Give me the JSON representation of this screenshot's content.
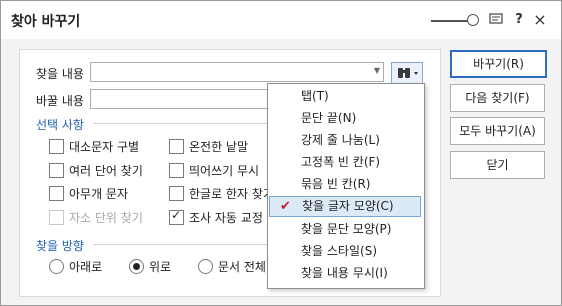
{
  "window": {
    "title": "찾아 바꾸기"
  },
  "titlebar": {
    "icons": [
      "slider-icon",
      "chat-icon",
      "help-icon",
      "close-icon"
    ],
    "help_glyph": "?",
    "close_glyph": "×"
  },
  "form": {
    "find_label": "찾을 내용",
    "find_value": "",
    "replace_label": "바꿀 내용",
    "replace_value": ""
  },
  "options": {
    "section_label": "선택 사항",
    "items": [
      {
        "label": "대소문자 구별",
        "checked": false,
        "enabled": true
      },
      {
        "label": "온전한 낱말",
        "checked": false,
        "enabled": true
      },
      {
        "label": "여러 단어 찾기",
        "checked": false,
        "enabled": true
      },
      {
        "label": "띄어쓰기 무시",
        "checked": false,
        "enabled": true
      },
      {
        "label": "아무개 문자",
        "checked": false,
        "enabled": true
      },
      {
        "label": "한글로 한자 찾기",
        "checked": false,
        "enabled": true
      },
      {
        "label": "자소 단위 찾기",
        "checked": false,
        "enabled": false
      },
      {
        "label": "조사 자동 교정",
        "checked": true,
        "enabled": true
      }
    ]
  },
  "direction": {
    "section_label": "찾을 방향",
    "options": [
      {
        "label": "아래로",
        "selected": false
      },
      {
        "label": "위로",
        "selected": true
      },
      {
        "label": "문서 전체",
        "selected": false
      }
    ]
  },
  "buttons": {
    "replace": "바꾸기(R)",
    "find_next": "다음 찾기(F)",
    "replace_all": "모두 바꾸기(A)",
    "close": "닫기"
  },
  "menu": {
    "items": [
      {
        "label": "탭(T)",
        "checked": false
      },
      {
        "label": "문단 끝(N)",
        "checked": false
      },
      {
        "label": "강제 줄 나눔(L)",
        "checked": false
      },
      {
        "label": "고정폭 빈 칸(F)",
        "checked": false
      },
      {
        "label": "묶음 빈 칸(R)",
        "checked": false
      },
      {
        "label": "찾을 글자 모양(C)",
        "checked": true
      },
      {
        "label": "찾을 문단 모양(P)",
        "checked": false
      },
      {
        "label": "찾을 스타일(S)",
        "checked": false
      },
      {
        "label": "찾을 내용 무시(I)",
        "checked": false
      }
    ]
  },
  "colors": {
    "accent": "#2e6bc6",
    "section": "#1f5fae",
    "check_mark": "#c0202c"
  }
}
